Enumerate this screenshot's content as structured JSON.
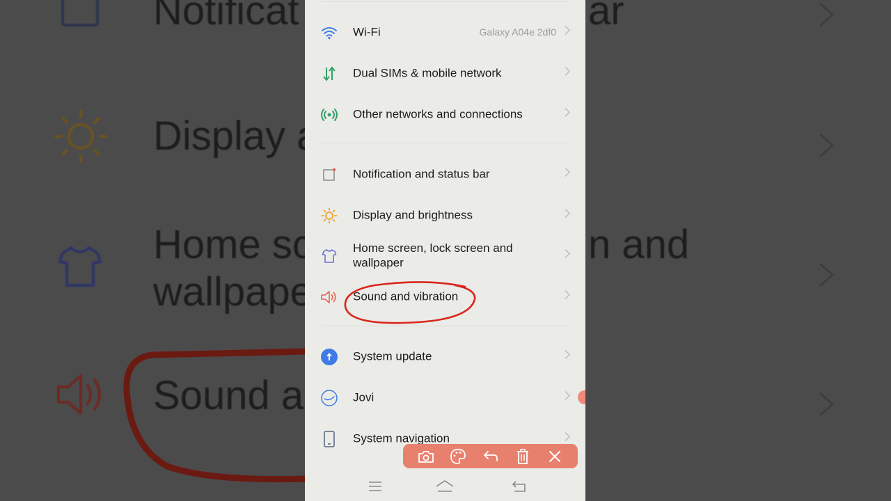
{
  "background_zoom": {
    "texts": {
      "notification": "Notificat",
      "notification_tail": "ar",
      "display": "Display a",
      "home_line1": "Home sc",
      "home_line1_tail": "n and",
      "home_line2": "wallpape",
      "sound": "Sound ar"
    }
  },
  "settings": {
    "groups": [
      {
        "items": [
          {
            "label": "Wi-Fi",
            "value": "Galaxy A04e 2df0",
            "icon": "wifi-icon",
            "icon_color": "#3f7be6"
          },
          {
            "label": "Dual SIMs & mobile network",
            "value": "",
            "icon": "mobile-data-icon",
            "icon_color": "#33a06a"
          },
          {
            "label": "Other networks and connections",
            "value": "",
            "icon": "connections-icon",
            "icon_color": "#33a06a"
          }
        ]
      },
      {
        "items": [
          {
            "label": "Notification and status bar",
            "value": "",
            "icon": "notification-icon",
            "icon_color": "#8a8a8a"
          },
          {
            "label": "Display and brightness",
            "value": "",
            "icon": "brightness-icon",
            "icon_color": "#f0a32a"
          },
          {
            "label": "Home screen, lock screen and wallpaper",
            "value": "",
            "icon": "theme-shirt-icon",
            "icon_color": "#6a73d6"
          },
          {
            "label": "Sound and vibration",
            "value": "",
            "icon": "speaker-icon",
            "icon_color": "#e3664f"
          }
        ]
      },
      {
        "items": [
          {
            "label": "System update",
            "value": "",
            "icon": "system-update-icon",
            "icon_color": "#3f7be6"
          },
          {
            "label": "Jovi",
            "value": "",
            "icon": "jovi-icon",
            "icon_color": "#3f7be6"
          },
          {
            "label": "System navigation",
            "value": "",
            "icon": "phone-icon",
            "icon_color": "#5a6b80"
          }
        ]
      }
    ]
  },
  "toolbar": {
    "buttons": [
      "camera-icon",
      "palette-icon",
      "undo-icon",
      "trash-icon",
      "close-icon"
    ],
    "color": "#e8806e"
  },
  "navbar": {
    "buttons": [
      "menu-icon",
      "home-icon",
      "back-icon"
    ]
  },
  "annotation": {
    "color": "#d9261c",
    "target": "Sound and vibration"
  }
}
